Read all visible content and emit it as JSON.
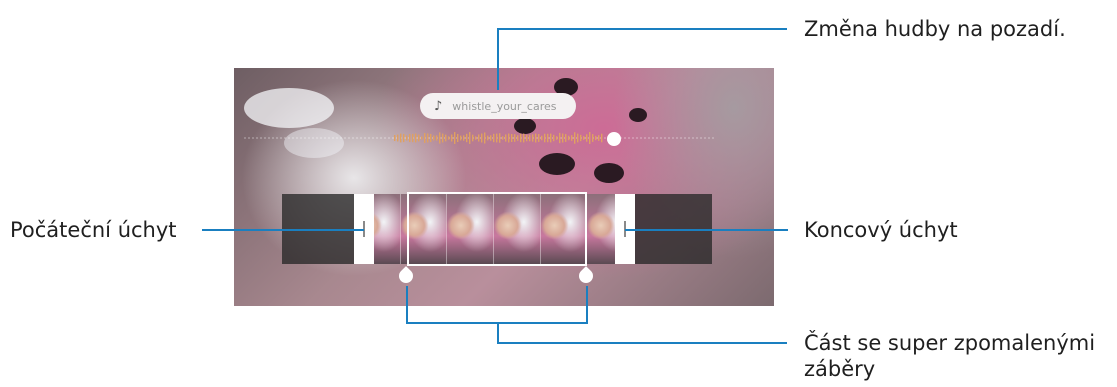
{
  "callouts": {
    "background_music": "Změna hudby na pozadí.",
    "start_handle": "Počáteční úchyt",
    "end_handle": "Koncový úchyt",
    "super_slow_part_line1": "Část se super zpomalenými",
    "super_slow_part_line2": "záběry"
  },
  "screen": {
    "music_track": "whistle_your_cares",
    "icons": [
      "music-note-icon"
    ]
  },
  "colors": {
    "callout_line": "#1a7fc0",
    "handle": "#ffffff",
    "waveform": "#e0a060"
  }
}
